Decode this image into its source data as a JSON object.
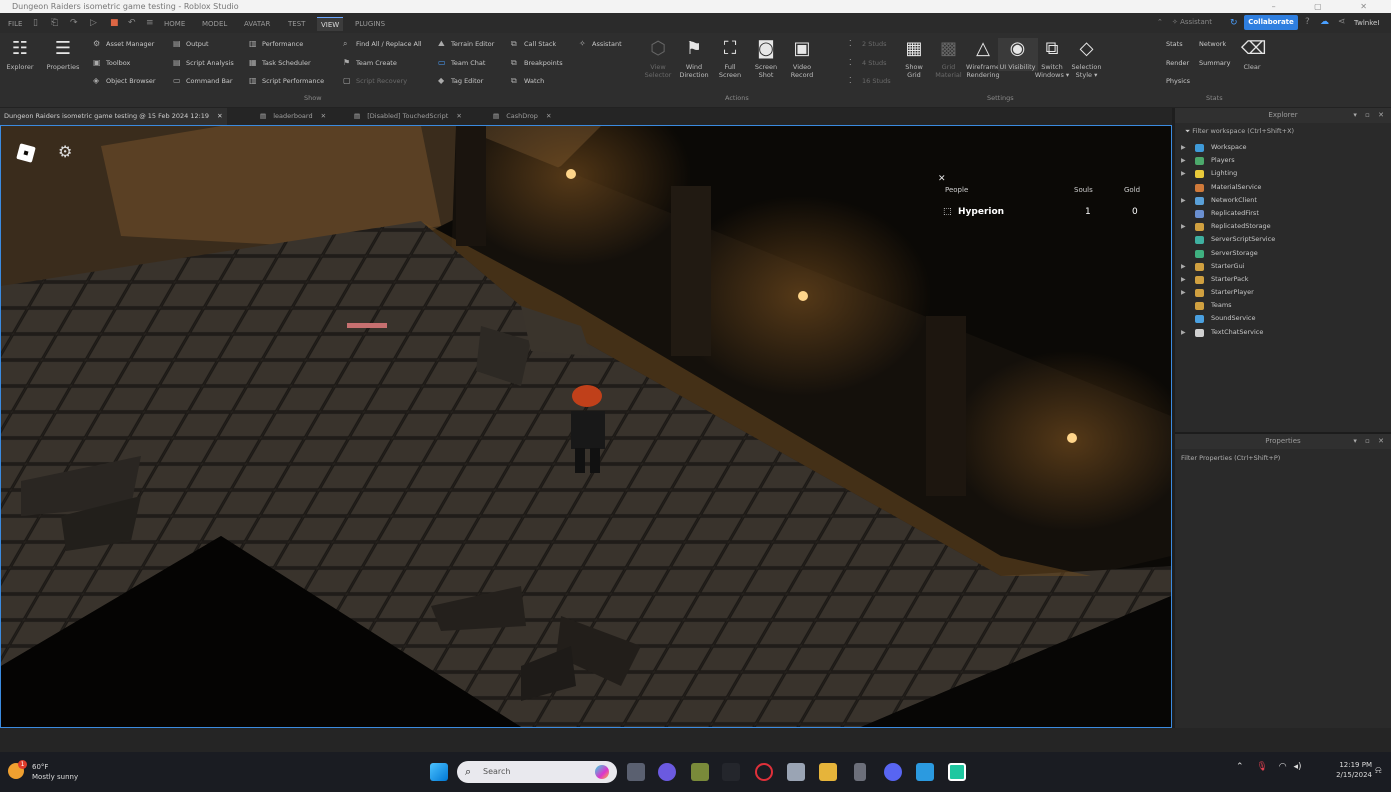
{
  "window": {
    "title": "Dungeon Raiders isometric game testing - Roblox Studio",
    "controls": "– ▢ ✕"
  },
  "menu": {
    "tabs": [
      "FILE",
      "HOME",
      "MODEL",
      "AVATAR",
      "TEST",
      "VIEW",
      "PLUGINS"
    ],
    "active_tab": "VIEW",
    "assistant": "Assistant",
    "collaborate": "Collaborate",
    "user": "TwlnkeI"
  },
  "ribbon": {
    "explorer": "Explorer",
    "properties": "Properties",
    "show_col1": [
      "Asset Manager",
      "Toolbox",
      "Object Browser"
    ],
    "show_col2": [
      "Output",
      "Script Analysis",
      "Command Bar"
    ],
    "show_col3": [
      "Performance",
      "Task Scheduler",
      "Script Performance"
    ],
    "show_col4": [
      "Find All / Replace All",
      "Team Create",
      "Script Recovery"
    ],
    "show_col5": [
      "Terrain Editor",
      "Team Chat",
      "Tag Editor"
    ],
    "show_col6": [
      "Call Stack",
      "Breakpoints",
      "Watch"
    ],
    "assistant": "Assistant",
    "group_show": "Show",
    "actions": [
      {
        "label": "View\nSelector",
        "icon": "cube-icon",
        "dim": true
      },
      {
        "label": "Wind\nDirection",
        "icon": "wind-flag-icon",
        "dim": false
      },
      {
        "label": "Full\nScreen",
        "icon": "fullscreen-icon",
        "dim": false
      },
      {
        "label": "Screen\nShot",
        "icon": "camera-icon",
        "dim": false
      },
      {
        "label": "Video\nRecord",
        "icon": "video-icon",
        "dim": false
      }
    ],
    "group_actions": "Actions",
    "studs": [
      "2 Studs",
      "4 Studs",
      "16 Studs"
    ],
    "settings": [
      {
        "label": "Show\nGrid",
        "icon": "grid-icon",
        "dim": false
      },
      {
        "label": "Grid\nMaterial",
        "icon": "grid-material-icon",
        "dim": true
      },
      {
        "label": "Wireframe\nRendering",
        "icon": "wireframe-icon",
        "dim": false
      },
      {
        "label": "UI Visibility",
        "icon": "eye-icon",
        "dim": false
      },
      {
        "label": "Switch\nWindows ▾",
        "icon": "switch-windows-icon",
        "dim": false
      },
      {
        "label": "Selection\nStyle ▾",
        "icon": "selection-style-icon",
        "dim": false
      }
    ],
    "group_settings": "Settings",
    "stats": [
      "Stats",
      "Render",
      "Physics"
    ],
    "stats2": [
      "Network",
      "Summary"
    ],
    "clear": "Clear",
    "group_stats": "Stats"
  },
  "doc_tabs": [
    {
      "label": "Dungeon Raiders isometric game testing @ 15 Feb 2024 12:19",
      "active": true
    },
    {
      "label": "leaderboard",
      "active": false
    },
    {
      "label": "[Disabled] TouchedScript",
      "active": false
    },
    {
      "label": "CashDrop",
      "active": false
    }
  ],
  "leaderboard": {
    "headers": [
      "People",
      "Souls",
      "Gold"
    ],
    "rows": [
      {
        "name": "Hyperion",
        "souls": "1",
        "gold": "0"
      }
    ]
  },
  "explorer": {
    "title": "Explorer",
    "filter": "Filter workspace (Ctrl+Shift+X)",
    "items": [
      {
        "label": "Workspace",
        "color": "#3f9ad8",
        "arrow": true
      },
      {
        "label": "Players",
        "color": "#4ca86b",
        "arrow": true
      },
      {
        "label": "Lighting",
        "color": "#e8c93a",
        "arrow": true
      },
      {
        "label": "MaterialService",
        "color": "#d07a3a",
        "arrow": false
      },
      {
        "label": "NetworkClient",
        "color": "#5aa0d8",
        "arrow": true
      },
      {
        "label": "ReplicatedFirst",
        "color": "#6a8fd0",
        "arrow": false
      },
      {
        "label": "ReplicatedStorage",
        "color": "#d0a040",
        "arrow": true
      },
      {
        "label": "ServerScriptService",
        "color": "#3fb0a0",
        "arrow": false
      },
      {
        "label": "ServerStorage",
        "color": "#3fb080",
        "arrow": false
      },
      {
        "label": "StarterGui",
        "color": "#d0a040",
        "arrow": true
      },
      {
        "label": "StarterPack",
        "color": "#d0a040",
        "arrow": true
      },
      {
        "label": "StarterPlayer",
        "color": "#d0a040",
        "arrow": true
      },
      {
        "label": "Teams",
        "color": "#d0a040",
        "arrow": false
      },
      {
        "label": "SoundService",
        "color": "#4aa0e0",
        "arrow": false
      },
      {
        "label": "TextChatService",
        "color": "#d0d0d0",
        "arrow": true
      }
    ]
  },
  "properties": {
    "title": "Properties",
    "filter": "Filter Properties (Ctrl+Shift+P)"
  },
  "taskbar": {
    "weather_temp": "60°F",
    "weather_desc": "Mostly sunny",
    "weather_badge": "1",
    "search_placeholder": "Search",
    "time": "12:19 PM",
    "date": "2/15/2024"
  }
}
